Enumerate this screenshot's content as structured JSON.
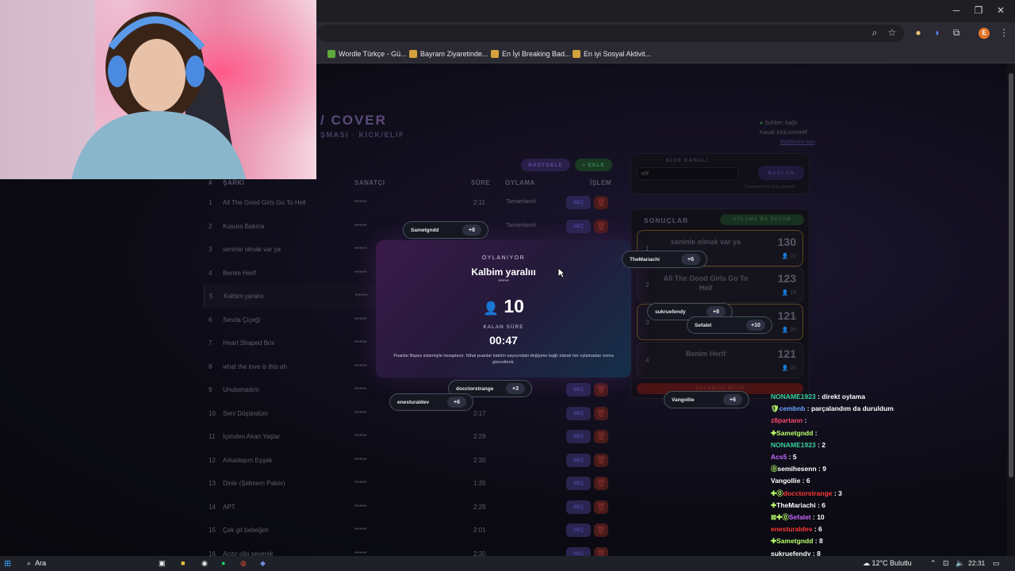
{
  "browser": {
    "bookmarks": [
      {
        "label": "Wordle Türkçe - Gü...",
        "color": "#5fa83a"
      },
      {
        "label": "Bayram Ziyaretinde...",
        "color": "#d4a23a"
      },
      {
        "label": "En İyi Breaking Bad...",
        "color": "#d4a23a"
      },
      {
        "label": "En iyi Sosyal Aktivit...",
        "color": "#d4a23a"
      }
    ],
    "profile_initial": "E"
  },
  "header": {
    "title": "/ COVER",
    "subtitle": "ŞMASI · KICK/ELİF",
    "status": "Sohbet: bağlı",
    "channel": "Kanal: kick.com/elif",
    "disconnect": "Bağlantıyı kes"
  },
  "actions": {
    "random": "RASTGELE",
    "add": "+ EKLE"
  },
  "table": {
    "headers": {
      "num": "#",
      "song": "ŞARKI",
      "artist": "SANATÇI",
      "duration": "SÜRE",
      "vote": "OYLAMA",
      "action": "İŞLEM"
    },
    "select_label": "SEÇ",
    "rows": [
      {
        "n": "1",
        "title": "All The Good Girls Go To Hell",
        "artist": "*****",
        "dur": "2:11",
        "vote": "Tamamlandı"
      },
      {
        "n": "2",
        "title": "Kusura Bakma",
        "artist": "*****",
        "dur": "",
        "vote": "Tamamlandı"
      },
      {
        "n": "3",
        "title": "seninle olmak var ya",
        "artist": "*****",
        "dur": "",
        "vote": ""
      },
      {
        "n": "4",
        "title": "Benim Herif",
        "artist": "*****",
        "dur": "",
        "vote": ""
      },
      {
        "n": "5",
        "title": "Kalbim yaralııı",
        "artist": "*****",
        "dur": "",
        "vote": ""
      },
      {
        "n": "6",
        "title": "Sevda Çiçeği",
        "artist": "*****",
        "dur": "",
        "vote": ""
      },
      {
        "n": "7",
        "title": "Heart Shaped Box",
        "artist": "*****",
        "dur": "",
        "vote": ""
      },
      {
        "n": "8",
        "title": "what the love is this ah",
        "artist": "*****",
        "dur": "",
        "vote": ""
      },
      {
        "n": "9",
        "title": "Unutamadım",
        "artist": "*****",
        "dur": "",
        "vote": ""
      },
      {
        "n": "10",
        "title": "Seni Düşündüm",
        "artist": "*****",
        "dur": "2:17",
        "vote": ""
      },
      {
        "n": "11",
        "title": "İçimden Akan Yaşlar",
        "artist": "*****",
        "dur": "2:29",
        "vote": ""
      },
      {
        "n": "12",
        "title": "Arkadaşım Eşşek",
        "artist": "*****",
        "dur": "2:30",
        "vote": ""
      },
      {
        "n": "13",
        "title": "Dinle (Şebnem Paker)",
        "artist": "*****",
        "dur": "1:35",
        "vote": ""
      },
      {
        "n": "14",
        "title": "APT",
        "artist": "*****",
        "dur": "2:29",
        "vote": ""
      },
      {
        "n": "15",
        "title": "Çek git bebeğim",
        "artist": "*****",
        "dur": "2:01",
        "vote": ""
      },
      {
        "n": "16",
        "title": "Acıtır gibi severek",
        "artist": "*****",
        "dur": "2:30",
        "vote": ""
      }
    ]
  },
  "kick": {
    "label": "KICK KANALI",
    "value": "elif",
    "button": "BAĞLAN",
    "hint": "Connected to kick.com/elif"
  },
  "results": {
    "title": "SONUÇLAR",
    "badge": "OYLAMA DA DEVAM",
    "items": [
      {
        "rank": "1",
        "title": "seninle olmak var ya",
        "sub": "*****",
        "score": "130",
        "count": "22"
      },
      {
        "rank": "2",
        "title": "All The Good Girls Go To Hell",
        "sub": "*****",
        "score": "123",
        "count": "19"
      },
      {
        "rank": "3",
        "title": "",
        "sub": "",
        "score": "121",
        "count": "20"
      },
      {
        "rank": "4",
        "title": "Benim Herif",
        "sub": "*****",
        "score": "121",
        "count": "20"
      }
    ],
    "reset": "OYLAMAYI BİTİR"
  },
  "voting": {
    "label": "OYLANIYOR",
    "song": "Kalbim yaralııı",
    "artist": "*****",
    "voters": "10",
    "time_label": "KALAN SÜRE",
    "time": "00:47",
    "note": "Puanlar Bayes sistemiyle hesaplanır. Nihai puanlar katılım sayısındaki değişime bağlı olarak her oylamadan sonra güncellenir."
  },
  "floating_votes": [
    {
      "name": "Sametgndd",
      "points": "+8"
    },
    {
      "name": "TheMariachi",
      "points": "+6"
    },
    {
      "name": "sukruefendy",
      "points": "+8"
    },
    {
      "name": "Sefalet",
      "points": "+10"
    },
    {
      "name": "docctorstrange",
      "points": "+3"
    },
    {
      "name": "enesturaldev",
      "points": "+6"
    },
    {
      "name": "Vangollie",
      "points": "+6"
    }
  ],
  "chat": [
    {
      "user": "NONAME1923",
      "msg": ": direkt oylama",
      "color": "#3ad19c",
      "badge": ""
    },
    {
      "user": "cembnb",
      "msg": ": parçalandım da duruldum",
      "color": "#6aa8ff",
      "badge": "🛡"
    },
    {
      "user": "z8partann",
      "msg": ":",
      "color": "#ff4a6a",
      "badge": ""
    },
    {
      "user": "Sametgndd",
      "msg": ":",
      "color": "#b8ff6a",
      "badge": "✚"
    },
    {
      "user": "NONAME1923",
      "msg": ": 2",
      "color": "#3ad19c",
      "badge": ""
    },
    {
      "user": "Acs5",
      "msg": ": 5",
      "color": "#c86aff",
      "badge": ""
    },
    {
      "user": "semihesenn",
      "msg": ": 9",
      "color": "#ffffff",
      "badge": "⓪"
    },
    {
      "user": "Vangollie",
      "msg": ": 6",
      "color": "#ffffff",
      "badge": ""
    },
    {
      "user": "docctorstrange",
      "msg": ": 3",
      "color": "#ff3a3a",
      "badge": "✚⓪"
    },
    {
      "user": "TheMariachi",
      "msg": ": 6",
      "color": "#ffffff",
      "badge": "✚"
    },
    {
      "user": "Sefalet",
      "msg": ": 10",
      "color": "#c86aff",
      "badge": "⊠✚⓪"
    },
    {
      "user": "enesturaldev",
      "msg": ": 6",
      "color": "#ff3a3a",
      "badge": ""
    },
    {
      "user": "Sametgndd",
      "msg": ": 8",
      "color": "#b8ff6a",
      "badge": "✚"
    },
    {
      "user": "sukruefendy",
      "msg": ": 8",
      "color": "#ffffff",
      "badge": ""
    }
  ],
  "taskbar": {
    "search": "Ara",
    "weather": "12°C  Bulutlu",
    "time": "22:31"
  }
}
